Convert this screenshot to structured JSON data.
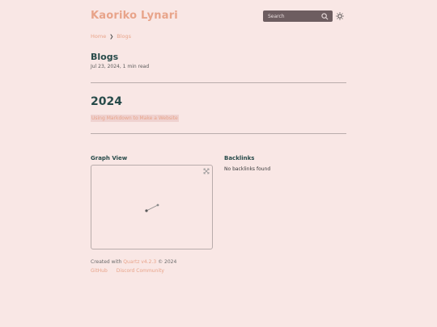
{
  "header": {
    "site_title": "Kaoriko Lynari",
    "search_placeholder": "Search"
  },
  "breadcrumb": {
    "home": "Home",
    "separator": "❯",
    "current": "Blogs"
  },
  "page": {
    "title": "Blogs",
    "meta": "Jul 23, 2024,  1 min read"
  },
  "listing": {
    "section_title": "2024",
    "posts": [
      "Using Markdown to Make a Website"
    ]
  },
  "graph": {
    "title": "Graph View",
    "nodes": [
      "node-a",
      "node-b"
    ]
  },
  "backlinks": {
    "title": "Backlinks",
    "empty_text": "No backlinks found"
  },
  "footer": {
    "created_prefix": "Created with ",
    "quartz_label": "Quartz v4.2.3",
    "year_suffix": " © 2024",
    "links": [
      "GitHub",
      "Discord Community"
    ]
  },
  "colors": {
    "background": "#f9e7e5",
    "accent": "#e8a48a",
    "heading": "#284b4a",
    "search_bg": "#6d5d60"
  }
}
